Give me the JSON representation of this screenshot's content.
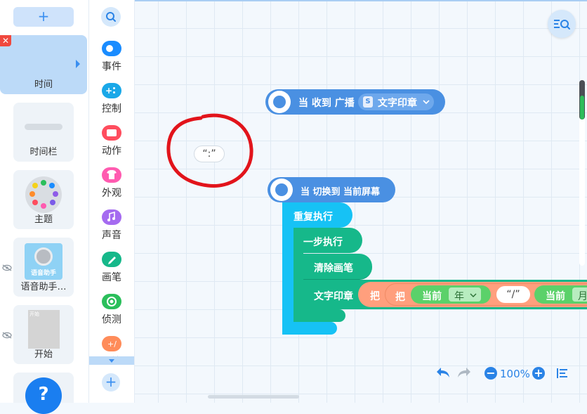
{
  "sprites_panel": {
    "add_label": "+",
    "items": [
      {
        "name": "时间",
        "selected": true
      },
      {
        "name": "时间栏"
      },
      {
        "name": "主题"
      },
      {
        "name": "语音助手…",
        "thumb_text": "语音助手"
      },
      {
        "name": "开始",
        "thumb_text": "开始"
      }
    ],
    "help_label": "?"
  },
  "categories": {
    "items": [
      {
        "label": "事件",
        "color": "#1a8cff"
      },
      {
        "label": "控制",
        "color": "#1aa8e8"
      },
      {
        "label": "动作",
        "color": "#ff4d5e"
      },
      {
        "label": "外观",
        "color": "#ff5bb0"
      },
      {
        "label": "声音",
        "color": "#a56bf0"
      },
      {
        "label": "画笔",
        "color": "#16b88a"
      },
      {
        "label": "侦测",
        "color": "#2bbf5b"
      },
      {
        "label": "运算",
        "color": "#ff8c5a"
      }
    ],
    "add_label": "+"
  },
  "workspace": {
    "loose_text": "“:”",
    "script1": {
      "hat_label": "当 收到 广播",
      "broadcast_badge": "S",
      "broadcast_value": "文字印章"
    },
    "script2": {
      "hat_label": "当 切换到 当前屏幕",
      "repeat_label": "重复执行",
      "step_label": "一步执行",
      "clear_label": "清除画笔",
      "stamp_label": "文字印章",
      "join1": "把",
      "join2": "把",
      "current1": "当前",
      "year": "年",
      "slash": "“/”",
      "current2": "当前",
      "month": "月"
    },
    "zoom_level": "100%"
  },
  "colors": {
    "event": "#4a90e2",
    "control": "#16c2f5",
    "control_dark": "#0ba8d8",
    "pen": "#16b88a",
    "pen_dark": "#0f9a73",
    "operator": "#ff9f7d",
    "sensing": "#5bd16a",
    "annotation": "#e2141b"
  }
}
